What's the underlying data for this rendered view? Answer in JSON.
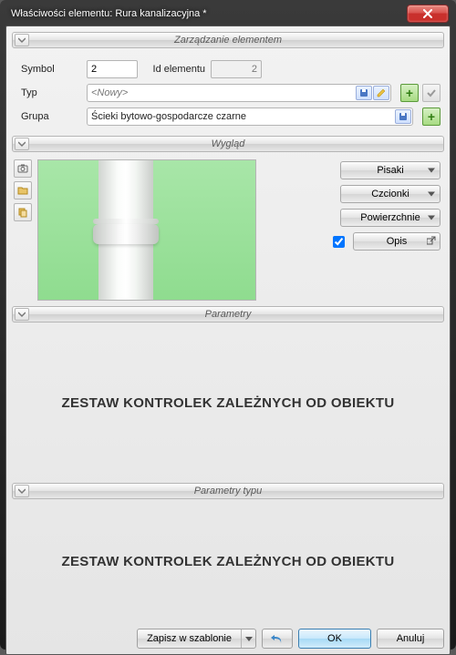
{
  "window": {
    "title": "Właściwości elementu: Rura kanalizacyjna *"
  },
  "sections": {
    "management": {
      "title": "Zarządzanie elementem"
    },
    "appearance": {
      "title": "Wygląd"
    },
    "parameters": {
      "title": "Parametry"
    },
    "type_parameters": {
      "title": "Parametry typu"
    }
  },
  "labels": {
    "symbol": "Symbol",
    "id": "Id elementu",
    "type": "Typ",
    "group": "Grupa"
  },
  "values": {
    "symbol": "2",
    "id": "2",
    "type": "<Nowy>",
    "group": "Ścieki bytowo-gospodarcze czarne"
  },
  "appearance_buttons": {
    "pens": "Pisaki",
    "fonts": "Czcionki",
    "surfaces": "Powierzchnie",
    "desc": "Opis"
  },
  "placeholder_text": "ZESTAW KONTROLEK ZALEŻNYCH OD OBIEKTU",
  "footer": {
    "save_template": "Zapisz w szablonie",
    "ok": "OK",
    "cancel": "Anuluj"
  },
  "colors": {
    "accent": "#3c7fb1"
  }
}
